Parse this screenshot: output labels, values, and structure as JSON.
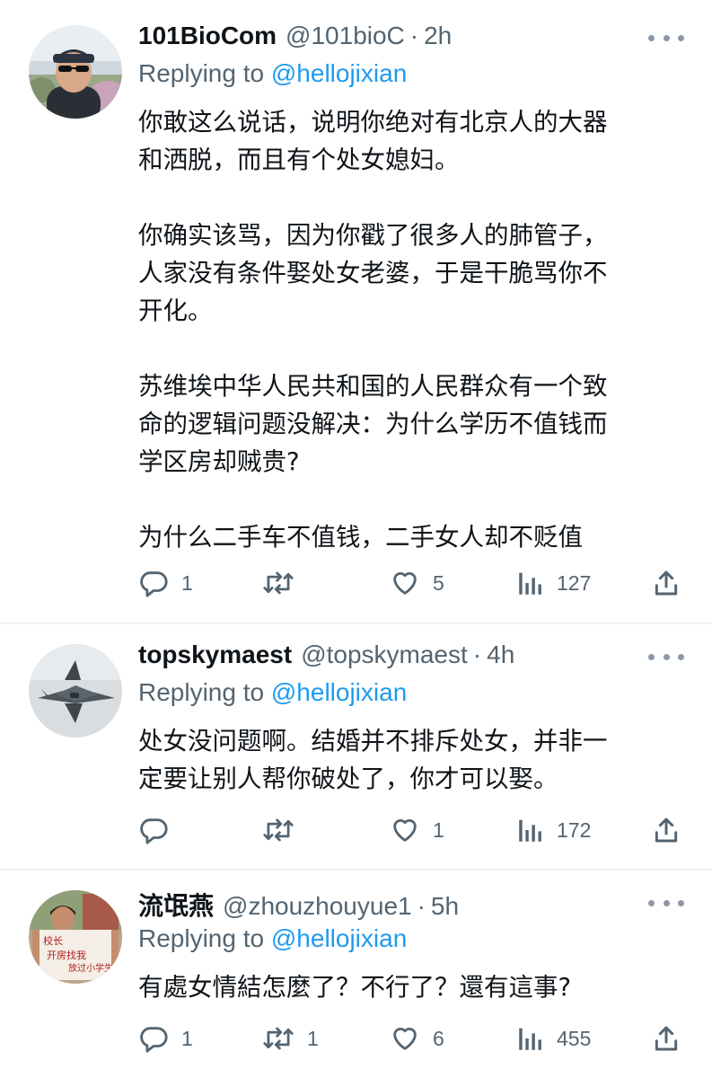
{
  "tweets": [
    {
      "name": "101BioCom",
      "handle": "@101bioC",
      "separator": "·",
      "time": "2h",
      "replying_prefix": "Replying to",
      "replying_to": "@hellojixian",
      "avatar_icon": "person-with-cap-and-sunglasses-photo",
      "lines": [
        "你敢这么说话，说明你绝对有北京人的大器",
        "和洒脱，而且有个处女媳妇。",
        "",
        "你确实该骂，因为你戳了很多人的肺管子，",
        "人家没有条件娶处女老婆，于是干脆骂你不",
        "开化。",
        "",
        "苏维埃中华人民共和国的人民群众有一个致",
        "命的逻辑问题没解决：为什么学历不值钱而",
        "学区房却贼贵?",
        "",
        "为什么二手车不值钱，二手女人却不贬值"
      ],
      "reply_count": "1",
      "retweet_count": "",
      "like_count": "5",
      "view_count": "127"
    },
    {
      "name": "topskymaest",
      "handle": "@topskymaest",
      "separator": "·",
      "time": "4h",
      "replying_prefix": "Replying to",
      "replying_to": "@hellojixian",
      "avatar_icon": "fighter-jet-photo",
      "lines": [
        "处女没问题啊。结婚并不排斥处女，并非一",
        "定要让别人帮你破处了，你才可以娶。"
      ],
      "reply_count": "",
      "retweet_count": "",
      "like_count": "1",
      "view_count": "172"
    },
    {
      "name": "流氓燕",
      "handle": "@zhouzhouyue1",
      "separator": "·",
      "time": "5h",
      "replying_prefix": "Replying to",
      "replying_to": "@hellojixian",
      "avatar_icon": "woman-holding-protest-sign-photo",
      "lines": [
        "有處女情結怎麼了？不行了？還有這事?"
      ],
      "reply_count": "1",
      "retweet_count": "1",
      "like_count": "6",
      "view_count": "455"
    }
  ],
  "colors": {
    "text": "#0f1419",
    "secondary": "#536471",
    "link": "#1d9bf0",
    "divider": "#eff3f4"
  }
}
